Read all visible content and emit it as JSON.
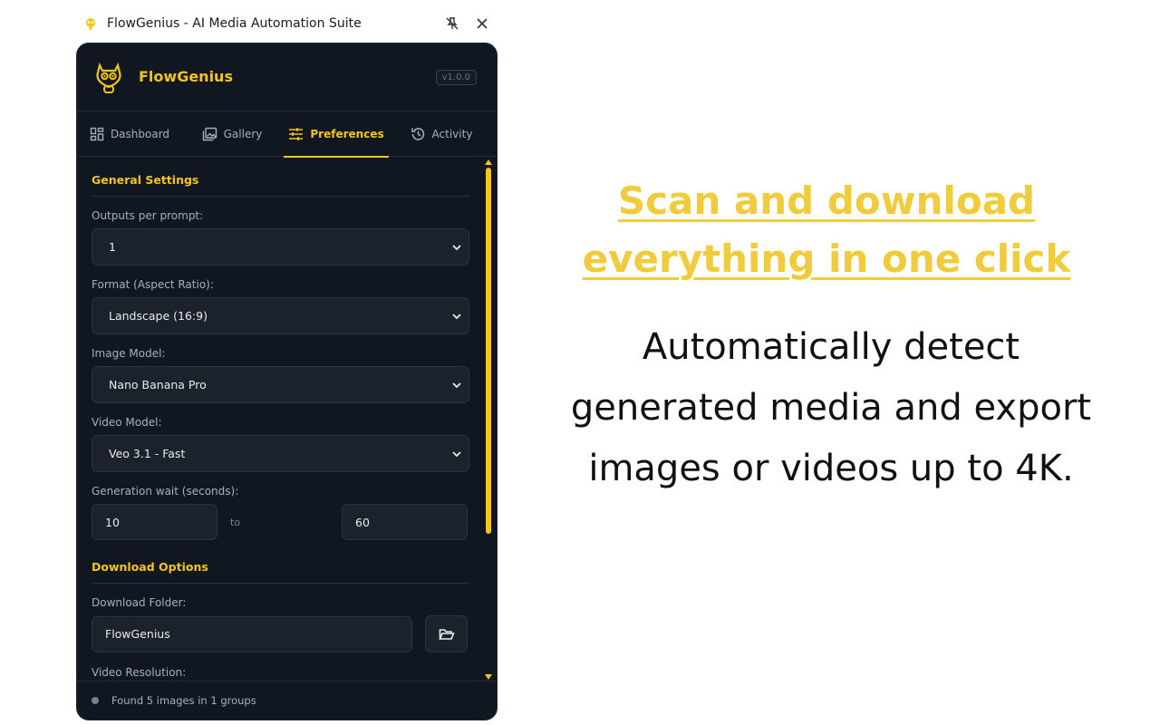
{
  "window": {
    "title": "FlowGenius - AI Media Automation Suite"
  },
  "header": {
    "brand": "FlowGenius",
    "version": "v1.0.0"
  },
  "tabs": [
    {
      "label": "Dashboard",
      "icon": "dashboard-icon",
      "active": false
    },
    {
      "label": "Gallery",
      "icon": "gallery-icon",
      "active": false
    },
    {
      "label": "Preferences",
      "icon": "sliders-icon",
      "active": true
    },
    {
      "label": "Activity",
      "icon": "history-icon",
      "active": false
    }
  ],
  "general": {
    "title": "General Settings",
    "outputs_label": "Outputs per prompt:",
    "outputs_value": "1",
    "format_label": "Format (Aspect Ratio):",
    "format_value": "Landscape (16:9)",
    "image_model_label": "Image Model:",
    "image_model_value": "Nano Banana Pro",
    "video_model_label": "Video Model:",
    "video_model_value": "Veo 3.1 - Fast",
    "wait_label": "Generation wait (seconds):",
    "wait_min": "10",
    "wait_to": "to",
    "wait_max": "60"
  },
  "download": {
    "title": "Download Options",
    "folder_label": "Download Folder:",
    "folder_value": "FlowGenius",
    "resolution_label": "Video Resolution:"
  },
  "footer": {
    "status": "Found 5 images in 1 groups"
  },
  "promo": {
    "headline_line1": "Scan and download",
    "headline_line2": "everything in one click",
    "sub_line1": "Automatically detect",
    "sub_line2": "generated media and export",
    "sub_line3": "images or videos up to 4K."
  },
  "colors": {
    "accent": "#f5c518",
    "panel_bg": "#111720",
    "field_bg": "#1b222c",
    "headline": "#f0cb3b"
  }
}
